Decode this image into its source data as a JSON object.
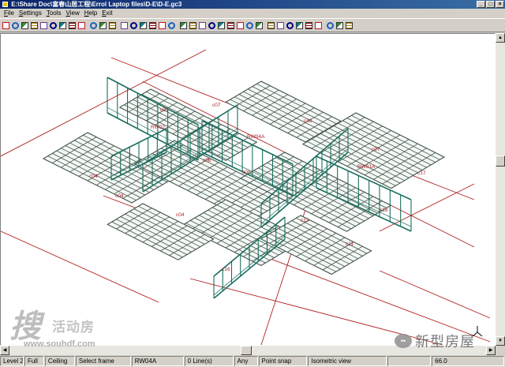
{
  "window": {
    "title": "E:\\Share Doc\\富春山居工程\\Errol Laptop files\\D-E\\D-E.gc3"
  },
  "menu": [
    "File",
    "Settings",
    "Tools",
    "View",
    "Help",
    "Exit"
  ],
  "toolbar": {
    "icons": [
      "panel-tool-icon",
      "panel-copy-icon",
      "door-icon",
      "pencil-icon",
      "mesh-icon",
      "shield-icon",
      "grid-icon",
      "fill-icon",
      "grid-icon",
      "window-icon",
      "layers-icon",
      "truss-icon",
      "snap-icon",
      "move-icon",
      "zoom-icon",
      "zoom-in-icon",
      "zoom-out-icon",
      "pan-icon",
      "select-icon",
      "frame-icon",
      "view-icon",
      "eye-icon",
      "rotate-icon",
      "rotate-icon",
      "rotate-icon",
      "rotate-icon",
      "rotate-icon",
      "wall-icon",
      "beam-icon",
      "window-icon",
      "table-icon",
      "ruler-icon",
      "line-icon",
      "text-icon",
      "delete-icon",
      "undo-icon"
    ]
  },
  "canvas": {
    "labels": [
      {
        "text": "RW02"
      },
      {
        "text": "c07"
      },
      {
        "text": "c07"
      },
      {
        "text": "RW04A"
      },
      {
        "text": "c48"
      },
      {
        "text": "c04"
      },
      {
        "text": "c08"
      },
      {
        "text": "c06"
      },
      {
        "text": "c04"
      },
      {
        "text": "c04"
      },
      {
        "text": "RW01A"
      },
      {
        "text": "c17"
      },
      {
        "text": "c12"
      },
      {
        "text": "c11"
      },
      {
        "text": "c07"
      },
      {
        "text": "c16"
      },
      {
        "text": "c18"
      }
    ]
  },
  "statusbar": {
    "level": "Level 2",
    "mode": "Full",
    "ceiling": "Ceiling",
    "tool": "Select frame",
    "selected": "RW04A",
    "lines": "0 Line(s)",
    "any": "Any",
    "snap": "Point snap",
    "view": "Isometric view",
    "blank": "",
    "zoom": "66.0"
  },
  "watermark_left": {
    "logo": "搜",
    "text": "活动房",
    "url": "www.souhdf.com"
  },
  "watermark_right": {
    "text": "新型房屋"
  },
  "colors": {
    "titlebar": "#0a246a",
    "grid": "#41524b",
    "frame": "#1a6e60",
    "guide": "#b22222",
    "label": "#b0202a"
  }
}
